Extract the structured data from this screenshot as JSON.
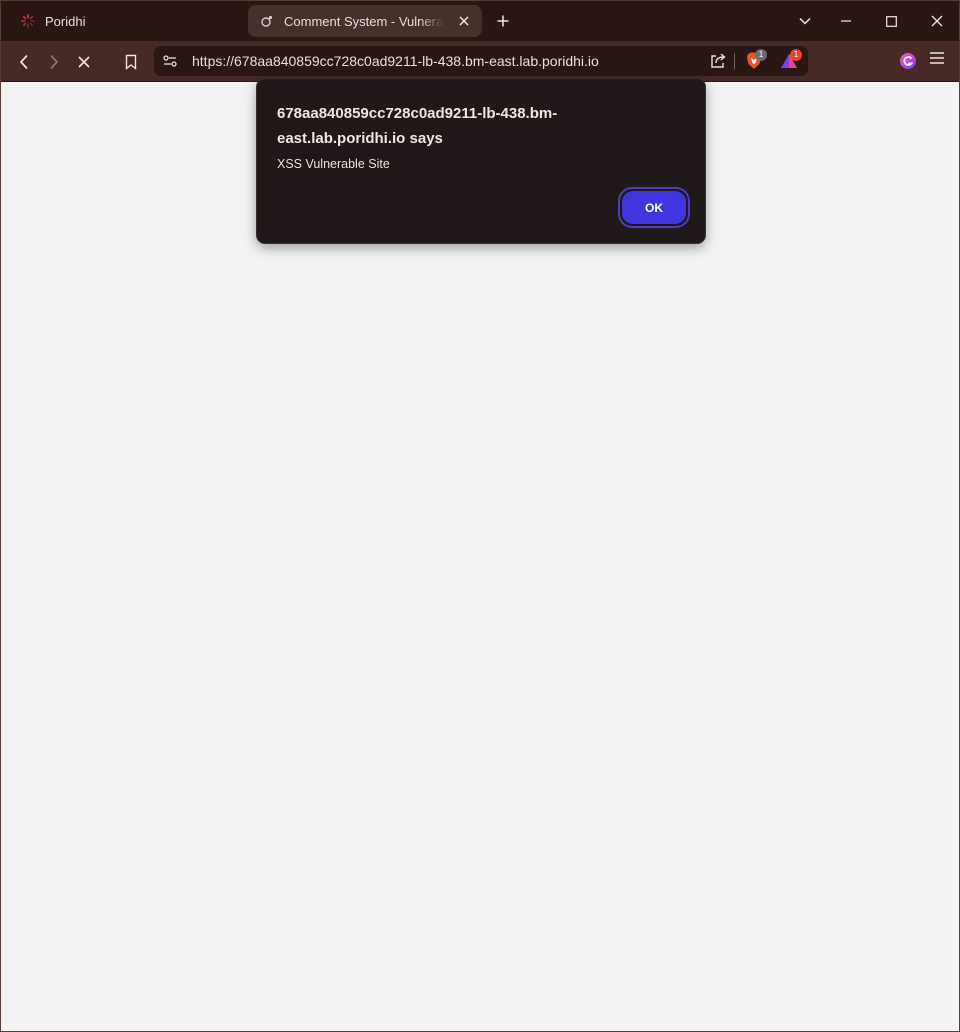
{
  "tabs": [
    {
      "title": "Poridhi",
      "active": false,
      "icon": "loading-spinner-icon"
    },
    {
      "title": "Comment System - Vulnerable",
      "active": true,
      "icon": "page-icon"
    }
  ],
  "toolbar": {
    "url": "https://678aa840859cc728c0ad9211-lb-438.bm-east.lab.poridhi.io",
    "brave_shields_count": "1",
    "rewards_count": "1"
  },
  "dialog": {
    "title": "678aa840859cc728c0ad9211-lb-438.bm-east.lab.poridhi.io says",
    "message": "XSS Vulnerable Site",
    "ok_label": "OK"
  },
  "colors": {
    "tabbar_bg": "#2a1714",
    "toolbar_bg": "#452a25",
    "dialog_bg": "#211819",
    "ok_button": "#4135e0",
    "page_bg": "#f3f3f3"
  }
}
